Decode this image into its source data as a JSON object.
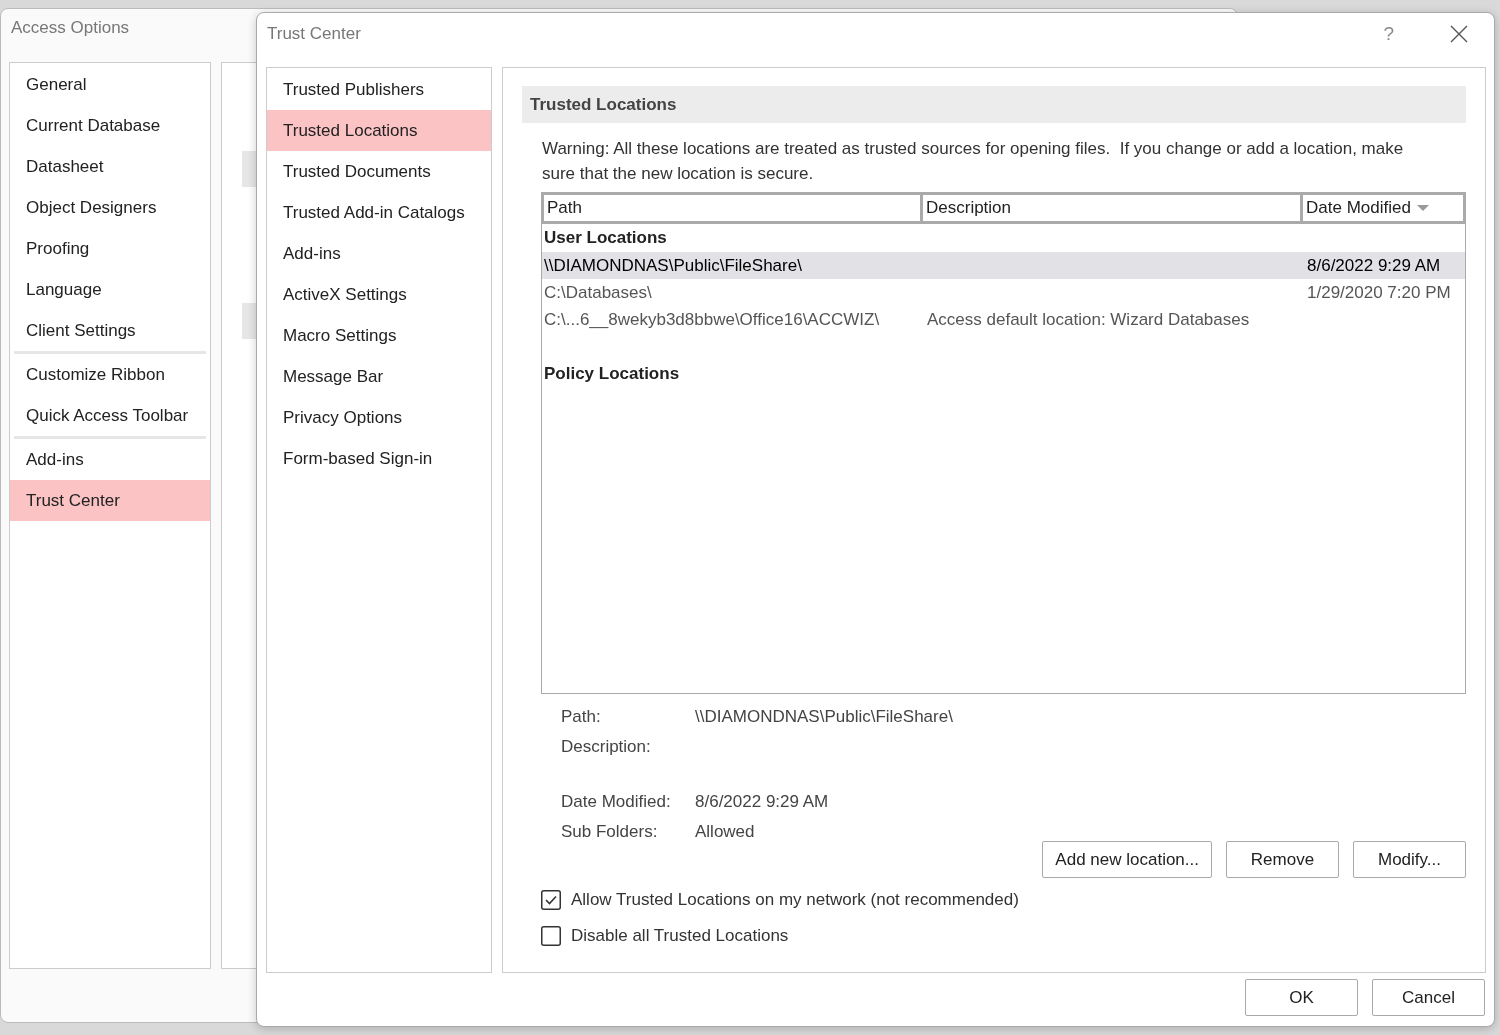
{
  "background_window": {
    "title": "Access Options",
    "nav_groups": [
      {
        "items": [
          {
            "label": "General",
            "selected": false
          },
          {
            "label": "Current Database",
            "selected": false
          },
          {
            "label": "Datasheet",
            "selected": false
          },
          {
            "label": "Object Designers",
            "selected": false
          },
          {
            "label": "Proofing",
            "selected": false
          },
          {
            "label": "Language",
            "selected": false
          },
          {
            "label": "Client Settings",
            "selected": false
          }
        ]
      },
      {
        "items": [
          {
            "label": "Customize Ribbon",
            "selected": false
          },
          {
            "label": "Quick Access Toolbar",
            "selected": false
          }
        ]
      },
      {
        "items": [
          {
            "label": "Add-ins",
            "selected": false
          },
          {
            "label": "Trust Center",
            "selected": true
          }
        ]
      }
    ]
  },
  "dialog": {
    "title": "Trust Center",
    "help_button": "?",
    "nav": [
      {
        "label": "Trusted Publishers",
        "selected": false
      },
      {
        "label": "Trusted Locations",
        "selected": true
      },
      {
        "label": "Trusted Documents",
        "selected": false
      },
      {
        "label": "Trusted Add-in Catalogs",
        "selected": false
      },
      {
        "label": "Add-ins",
        "selected": false
      },
      {
        "label": "ActiveX Settings",
        "selected": false
      },
      {
        "label": "Macro Settings",
        "selected": false
      },
      {
        "label": "Message Bar",
        "selected": false
      },
      {
        "label": "Privacy Options",
        "selected": false
      },
      {
        "label": "Form-based Sign-in",
        "selected": false
      }
    ],
    "section_title": "Trusted Locations",
    "warning": "Warning: All these locations are treated as trusted sources for opening files.  If you change or add a location, make sure that the new location is secure.",
    "table": {
      "columns": [
        {
          "label": "Path",
          "sorted": false
        },
        {
          "label": "Description",
          "sorted": false
        },
        {
          "label": "Date Modified",
          "sorted": true
        }
      ],
      "groups": [
        {
          "name": "User Locations",
          "rows": [
            {
              "path": "\\\\DIAMONDNAS\\Public\\FileShare\\",
              "date_modified": "8/6/2022 9:29 AM",
              "selected": true
            },
            {
              "path": "C:\\Databases\\",
              "date_modified": "1/29/2020 7:20 PM",
              "selected": false
            },
            {
              "path": "C:\\...6__8wekyb3d8bbwe\\Office16\\ACCWIZ\\",
              "description": "Access default location: Wizard Databases",
              "selected": false
            }
          ]
        },
        {
          "name": "Policy Locations"
        }
      ]
    },
    "details": [
      {
        "label": "Path:",
        "value": "\\\\DIAMONDNAS\\Public\\FileShare\\"
      },
      {
        "label": "Description:"
      },
      {
        "label": "Date Modified:",
        "value": "8/6/2022 9:29 AM"
      },
      {
        "label": "Sub Folders:",
        "value": "Allowed"
      }
    ],
    "buttons": [
      "Add new location...",
      "Remove",
      "Modify..."
    ],
    "checkboxes": [
      {
        "label": "Allow Trusted Locations on my network (not recommended)",
        "checked": true
      },
      {
        "label": "Disable all Trusted Locations",
        "checked": false
      }
    ],
    "footer_buttons": [
      "OK",
      "Cancel"
    ]
  }
}
